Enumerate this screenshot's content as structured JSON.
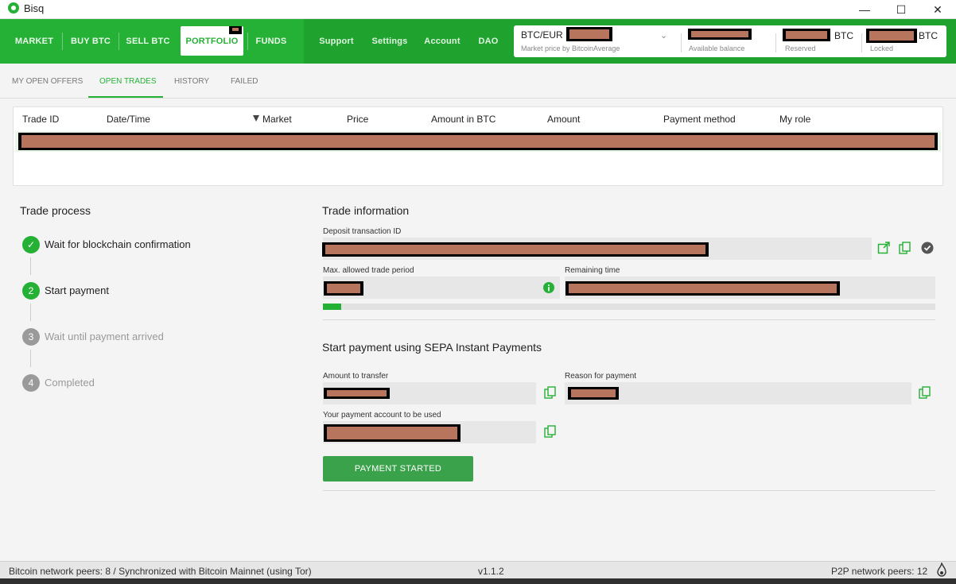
{
  "window": {
    "title": "Bisq",
    "minimize": "—",
    "maximize": "☐",
    "close": "✕"
  },
  "nav": {
    "items": [
      "MARKET",
      "BUY BTC",
      "SELL BTC",
      "PORTFOLIO",
      "FUNDS"
    ],
    "secondary": [
      "Support",
      "Settings",
      "Account",
      "DAO"
    ],
    "active": "PORTFOLIO"
  },
  "balances": {
    "market": "BTC/EUR",
    "market_sub": "Market price by BitcoinAverage",
    "available_sub": "Available balance",
    "reserved_unit": "BTC",
    "reserved_sub": "Reserved",
    "locked_unit": "BTC",
    "locked_sub": "Locked"
  },
  "subtabs": [
    "MY OPEN OFFERS",
    "OPEN TRADES",
    "HISTORY",
    "FAILED"
  ],
  "table": {
    "headers": [
      "Trade ID",
      "Date/Time",
      "Market",
      "Price",
      "Amount in BTC",
      "Amount",
      "Payment method",
      "My role"
    ]
  },
  "trade_process": {
    "title": "Trade process",
    "steps": [
      {
        "num": "✓",
        "label": "Wait for blockchain confirmation",
        "state": "done"
      },
      {
        "num": "2",
        "label": "Start payment",
        "state": "active"
      },
      {
        "num": "3",
        "label": "Wait until payment arrived",
        "state": "pending"
      },
      {
        "num": "4",
        "label": "Completed",
        "state": "pending"
      }
    ]
  },
  "trade_info": {
    "title": "Trade information",
    "deposit_label": "Deposit transaction ID",
    "max_period_label": "Max. allowed trade period",
    "remaining_label": "Remaining time",
    "progress_fraction": 0.03,
    "payment_title": "Start payment using SEPA Instant Payments",
    "amount_label": "Amount to transfer",
    "reason_label": "Reason for payment",
    "account_label": "Your payment account to be used",
    "button": "PAYMENT STARTED"
  },
  "status": {
    "left": "Bitcoin network peers: 8 / Synchronized with Bitcoin Mainnet (using Tor)",
    "version": "v1.1.2",
    "right": "P2P network peers: 12"
  },
  "colors": {
    "accent": "#25b135",
    "redaction": "#b7755e"
  }
}
